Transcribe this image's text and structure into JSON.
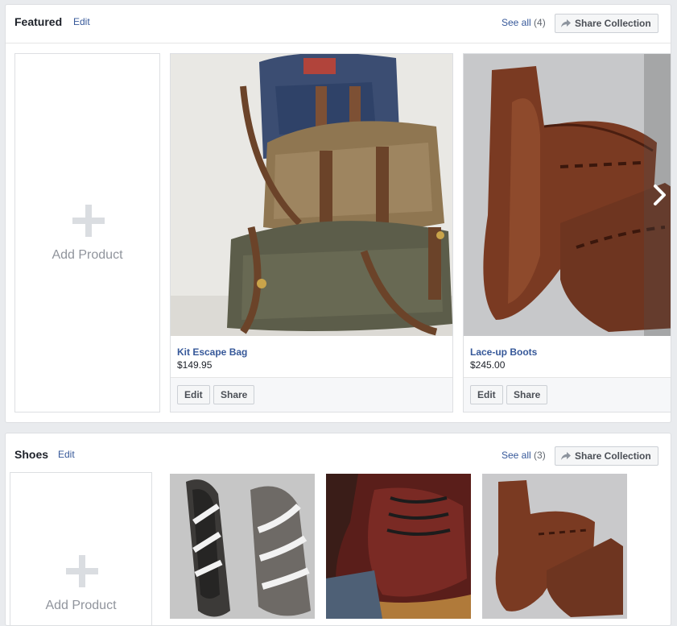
{
  "collections": [
    {
      "title": "Featured",
      "edit_label": "Edit",
      "see_all_label": "See all",
      "see_all_count": "(4)",
      "share_label": "Share Collection",
      "add_label": "Add Product",
      "products": [
        {
          "name": "Kit Escape Bag",
          "price": "$149.95",
          "edit_label": "Edit",
          "share_label": "Share"
        },
        {
          "name": "Lace-up Boots",
          "price": "$245.00",
          "edit_label": "Edit",
          "share_label": "Share"
        }
      ]
    },
    {
      "title": "Shoes",
      "edit_label": "Edit",
      "see_all_label": "See all",
      "see_all_count": "(3)",
      "share_label": "Share Collection",
      "add_label": "Add Product"
    }
  ],
  "icons": {
    "share": "share-arrow-icon",
    "plus": "plus-icon",
    "next": "chevron-right-icon"
  },
  "colors": {
    "link": "#365899",
    "page_bg": "#e9ebee",
    "border": "#dddfe2",
    "plus_gray": "#dadde1"
  }
}
